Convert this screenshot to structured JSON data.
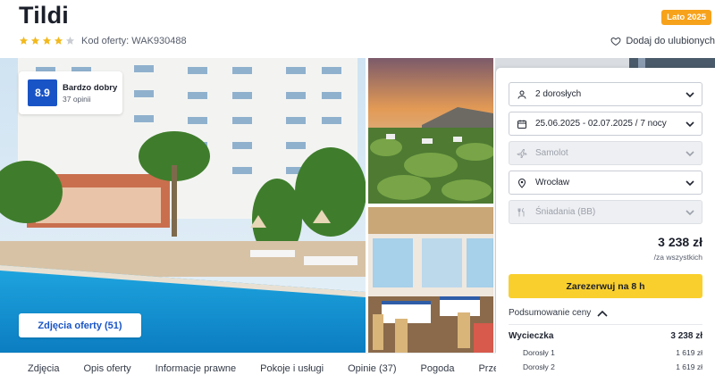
{
  "header": {
    "title": "Tildi",
    "rating_stars": 4,
    "stars_total": 5,
    "offer_code": "Kod oferty: WAK930488",
    "season_badge": "Lato 2025",
    "favorite_label": "Dodaj do ulubionych"
  },
  "gallery": {
    "rating_score": "8.9",
    "rating_label": "Bardzo dobry",
    "rating_count": "37 opinii",
    "photos_button": "Zdjęcia oferty (51)"
  },
  "booking": {
    "travellers": "2 dorosłych",
    "dates": "25.06.2025 - 02.07.2025 / 7 nocy",
    "transport": "Samolot",
    "departure": "Wrocław",
    "board": "Śniadania (BB)",
    "price": "3 238 zł",
    "price_note": "/za wszystkich",
    "book_button": "Zarezerwuj na 8 h",
    "summary_toggle": "Podsumowanie ceny",
    "summary": {
      "trip_label": "Wycieczka",
      "trip_value": "3 238 zł",
      "items": [
        {
          "label": "Dorosły 1",
          "value": "1 619 zł"
        },
        {
          "label": "Dorosły 2",
          "value": "1 619 zł"
        }
      ]
    }
  },
  "tabs": [
    "Zdjęcia",
    "Opis oferty",
    "Informacje prawne",
    "Pokoje i usługi",
    "Opinie (37)",
    "Pogoda",
    "Przed"
  ],
  "colors": {
    "accent_blue": "#1954c6",
    "book_yellow": "#f9cf2d",
    "badge_orange": "#f7a21b",
    "star_gold": "#f2b91e"
  },
  "icons": [
    "star-icon",
    "heart-icon",
    "user-icon",
    "calendar-icon",
    "plane-icon",
    "location-pin-icon",
    "fork-knife-icon",
    "chevron-down-icon",
    "chevron-up-icon"
  ]
}
